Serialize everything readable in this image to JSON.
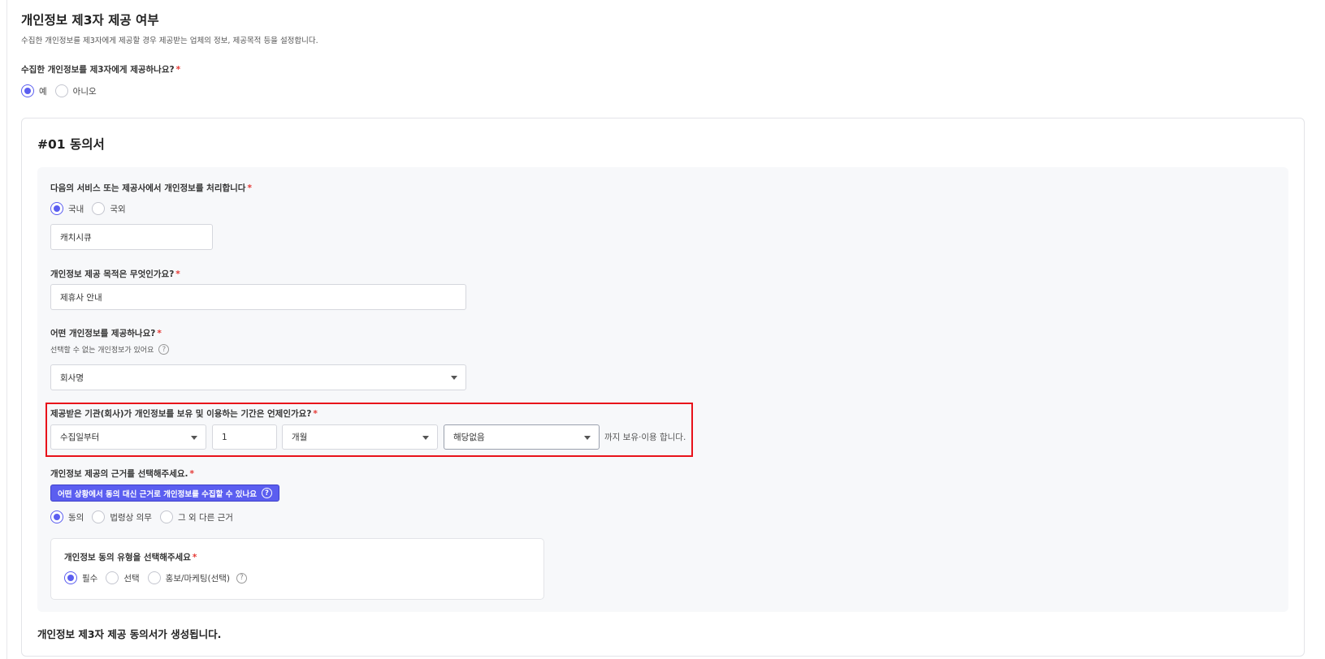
{
  "header": {
    "title": "개인정보 제3자 제공 여부",
    "description": "수집한 개인정보를 제3자에게 제공할 경우 제공받는 업체의 정보, 제공목적 등을 설정합니다."
  },
  "provide_question": {
    "label": "수집한 개인정보를 제3자에게 제공하나요?",
    "required_mark": "*",
    "options": [
      {
        "label": "예",
        "checked": true
      },
      {
        "label": "아니오",
        "checked": false
      }
    ]
  },
  "consent": {
    "title": "#01 동의서",
    "service": {
      "label": "다음의 서비스 또는 제공사에서 개인정보를 처리합니다",
      "required_mark": "*",
      "options": [
        {
          "label": "국내",
          "checked": true
        },
        {
          "label": "국외",
          "checked": false
        }
      ],
      "value": "캐치시큐"
    },
    "purpose": {
      "label": "개인정보 제공 목적은 무엇인가요?",
      "required_mark": "*",
      "value": "제휴사 안내"
    },
    "items": {
      "label": "어떤 개인정보를 제공하나요?",
      "required_mark": "*",
      "sub": "선택할 수 없는 개인정보가 있어요",
      "help_icon": "?",
      "value": "회사명"
    },
    "retention": {
      "label": "제공받은 기관(회사)가 개인정보를 보유 및 이용하는 기간은 언제인가요?",
      "required_mark": "*",
      "start_value": "수집일부터",
      "amount_value": "1",
      "unit_value": "개월",
      "extra_value": "해당없음",
      "suffix": "까지 보유·이용 합니다."
    },
    "basis": {
      "label": "개인정보 제공의 근거를 선택해주세요.",
      "required_mark": "*",
      "info_button": "어떤 상황에서 동의 대신 근거로 개인정보를 수집할 수 있나요",
      "help_icon": "?",
      "options": [
        {
          "label": "동의",
          "checked": true
        },
        {
          "label": "법령상 의무",
          "checked": false
        },
        {
          "label": "그 외 다른 근거",
          "checked": false
        }
      ]
    },
    "consent_type": {
      "label": "개인정보 동의 유형을 선택해주세요",
      "required_mark": "*",
      "help_icon": "?",
      "options": [
        {
          "label": "필수",
          "checked": true
        },
        {
          "label": "선택",
          "checked": false
        },
        {
          "label": "홍보/마케팅(선택)",
          "checked": false
        }
      ]
    },
    "footer": "개인정보 제3자 제공 동의서가 생성됩니다."
  },
  "colors": {
    "accent": "#5b5ef0",
    "required": "#e53935",
    "highlight": "#e8121a"
  }
}
